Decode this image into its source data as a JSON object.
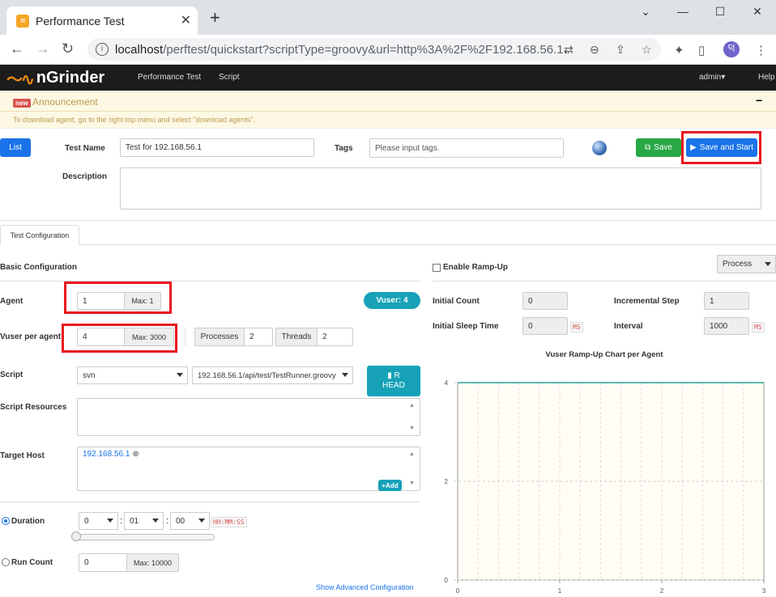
{
  "browser": {
    "tab_title": "Performance Test",
    "url_host": "localhost",
    "url_path": "/perftest/quickstart?scriptType=groovy&url=http%3A%2F%2F192.168.56.1...",
    "profile_initial": "덕"
  },
  "nav": {
    "logo_text": "nGrinder",
    "links": [
      "Performance Test",
      "Script"
    ],
    "user": "admin",
    "help": "Help"
  },
  "announcement": {
    "badge": "new",
    "title": "Announcement",
    "collapse": "−",
    "text": "To download agent, go to the right-top menu and select \"download agents\"."
  },
  "header": {
    "list_button": "List",
    "test_name_label": "Test Name",
    "test_name_value": "Test for 192.168.56.1",
    "tags_label": "Tags",
    "tags_placeholder": "Please input tags.",
    "save_button": "Save",
    "save_and_start_button": "Save and Start",
    "description_label": "Description"
  },
  "tabs": [
    "Test Configuration"
  ],
  "basic": {
    "section_title": "Basic Configuration",
    "agent_label": "Agent",
    "agent_value": "1",
    "agent_max": "Max: 1",
    "vuser_badge": "Vuser: 4",
    "vuser_per_agent_label": "Vuser per agent",
    "vuser_value": "4",
    "vuser_max": "Max: 3000",
    "processes_label": "Processes",
    "processes_value": "2",
    "threads_label": "Threads",
    "threads_value": "2",
    "script_label": "Script",
    "script_repo": "svn",
    "script_path": "192.168.56.1/api/test/TestRunner.groovy",
    "head_button_line1": "R",
    "head_button_line2": "HEAD",
    "script_resources_label": "Script Resources",
    "target_host_label": "Target Host",
    "target_host_value": "192.168.56.1",
    "add_button": "Add",
    "duration_label": "Duration",
    "duration_h": "0",
    "duration_m": "01",
    "duration_s": "00",
    "duration_format": "HH:MM:SS",
    "run_count_label": "Run Count",
    "run_count_value": "0",
    "run_count_max": "Max: 10000",
    "advanced_link": "Show Advanced Configuration"
  },
  "rampup": {
    "enable_label": "Enable Ramp-Up",
    "mode": "Process",
    "initial_count_label": "Initial Count",
    "initial_count_value": "0",
    "incremental_step_label": "Incremental Step",
    "incremental_step_value": "1",
    "initial_sleep_label": "Initial Sleep Time",
    "initial_sleep_value": "0",
    "interval_label": "Interval",
    "interval_value": "1000",
    "ms_unit": "MS"
  },
  "chart_data": {
    "type": "line",
    "title": "Vuser Ramp-Up Chart per Agent",
    "xlim": [
      0,
      3
    ],
    "ylim": [
      0,
      4
    ],
    "x_ticks": [
      "0",
      "1",
      "2",
      "3"
    ],
    "y_ticks": [
      "0",
      "2",
      "4"
    ],
    "series": [
      {
        "x": [
          0,
          3
        ],
        "values": [
          4,
          4
        ],
        "color": "#2aa198"
      }
    ]
  },
  "colors": {
    "nav_bg": "#1c1c1c",
    "primary": "#1a73e8",
    "save_green": "#28a745",
    "teal": "#17a2b8",
    "highlight_red": "#e8171e"
  }
}
